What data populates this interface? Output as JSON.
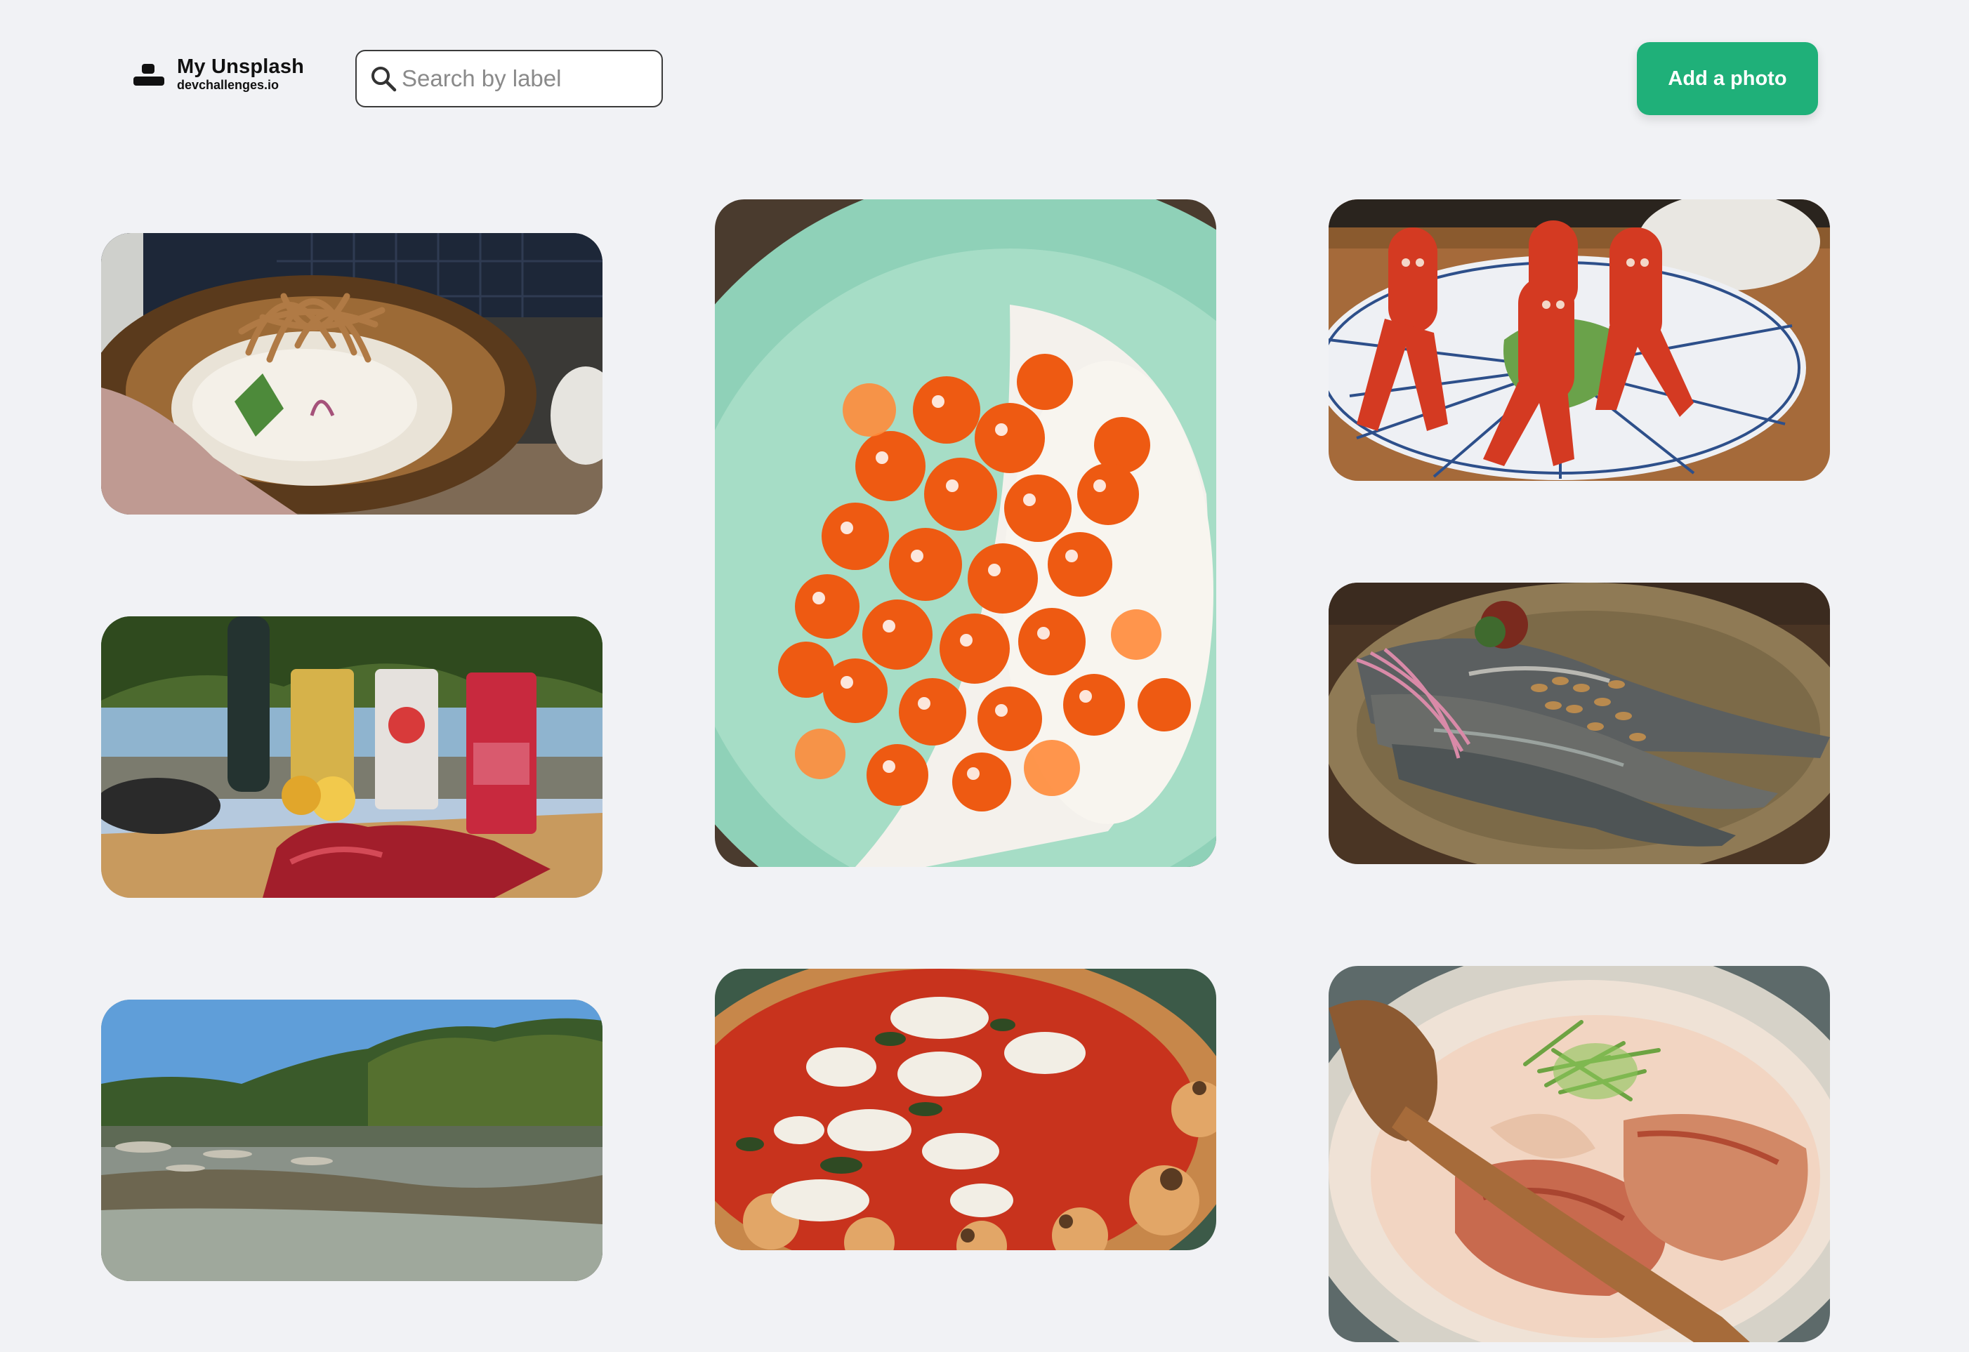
{
  "brand": {
    "title": "My Unsplash",
    "subtitle": "devchallenges.io"
  },
  "search": {
    "placeholder": "Search by label",
    "value": ""
  },
  "actions": {
    "add_photo_label": "Add a photo"
  },
  "colors": {
    "background": "#f1f2f5",
    "accent": "#1fb079",
    "text": "#111111"
  },
  "gallery": {
    "columns": 3,
    "photos": [
      {
        "subject": "ramen-bowl"
      },
      {
        "subject": "beer-cans-and-meat"
      },
      {
        "subject": "river-landscape"
      },
      {
        "subject": "salmon-roe"
      },
      {
        "subject": "margherita-pizza"
      },
      {
        "subject": "sausage-octopus"
      },
      {
        "subject": "grilled-sardines"
      },
      {
        "subject": "tonkotsu-ramen"
      }
    ]
  }
}
